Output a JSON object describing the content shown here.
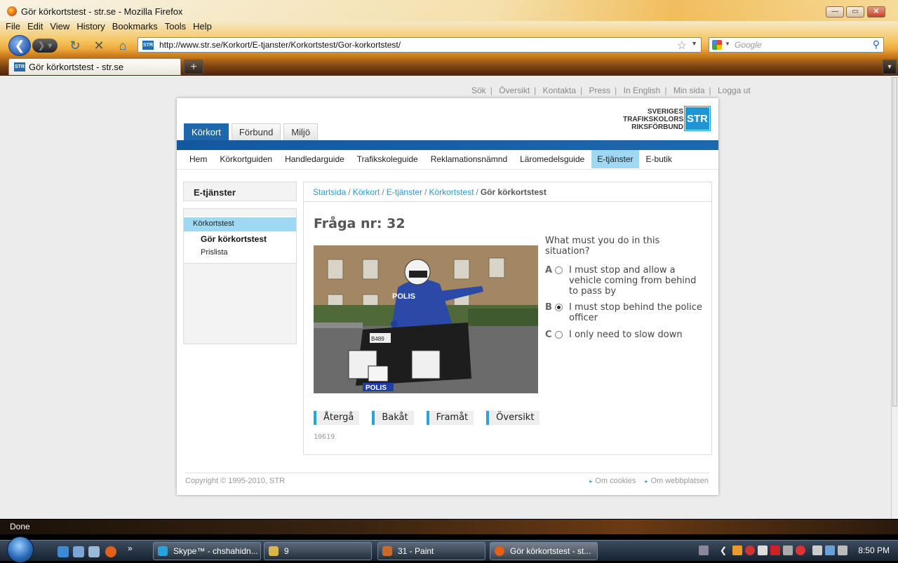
{
  "window": {
    "title": "Gör körkortstest - str.se - Mozilla Firefox"
  },
  "menu": [
    "File",
    "Edit",
    "View",
    "History",
    "Bookmarks",
    "Tools",
    "Help"
  ],
  "nav": {
    "url": "http://www.str.se/Korkort/E-tjanster/Korkortstest/Gor-korkortstest/",
    "search_placeholder": "Google",
    "site_icon": "STR"
  },
  "tab": {
    "label": "Gör körkortstest - str.se",
    "newtab": "+"
  },
  "site": {
    "top_links": [
      "Sök",
      "Översikt",
      "Kontakta",
      "Press",
      "In English",
      "Min sida",
      "Logga ut"
    ],
    "logo_text": "SVERIGES\nTRAFIKSKOLORS\nRIKSFÖRBUND",
    "logo_mark": "STR",
    "main_tabs": [
      {
        "label": "Körkort",
        "active": true
      },
      {
        "label": "Förbund",
        "active": false
      },
      {
        "label": "Miljö",
        "active": false
      }
    ],
    "sub_nav": [
      {
        "label": "Hem"
      },
      {
        "label": "Körkortguiden"
      },
      {
        "label": "Handledarguide"
      },
      {
        "label": "Trafikskoleguide"
      },
      {
        "label": "Reklamationsnämnd"
      },
      {
        "label": "Läromedelsguide"
      },
      {
        "label": "E-tjänster",
        "active": true
      },
      {
        "label": "E-butik"
      }
    ],
    "sidebar": {
      "heading": "E-tjänster",
      "section": "Körkortstest",
      "current": "Gör körkortstest",
      "other": "Prislista"
    },
    "breadcrumb": {
      "links": [
        "Startsida",
        "Körkort",
        "E-tjänster",
        "Körkortstest"
      ],
      "current": "Gör körkortstest"
    },
    "quiz": {
      "title": "Fråga nr: 32",
      "question": "What must you do in this situation?",
      "options": [
        {
          "letter": "A",
          "text": "I must stop and allow a vehicle coming from behind to pass by",
          "selected": false
        },
        {
          "letter": "B",
          "text": "I must stop behind the police officer",
          "selected": true
        },
        {
          "letter": "C",
          "text": "I only need to slow down",
          "selected": false
        }
      ],
      "buttons": [
        "Återgå",
        "Bakåt",
        "Framåt",
        "Översikt"
      ],
      "question_id": "10619"
    },
    "footer": {
      "copyright": "Copyright © 1995-2010, STR",
      "links": [
        "Om cookies",
        "Om webbplatsen"
      ]
    }
  },
  "status": {
    "text": "Done"
  },
  "taskbar": {
    "tasks": [
      {
        "label": "Skype™ - chshahidn...",
        "color": "#2aa3dc"
      },
      {
        "label": "9",
        "color": "#d9b54a"
      },
      {
        "label": "31 - Paint",
        "color": "#c86a2a"
      },
      {
        "label": "Gör körkortstest - st...",
        "color": "#e2601a",
        "active": true
      }
    ],
    "clock": "8:50 PM"
  }
}
